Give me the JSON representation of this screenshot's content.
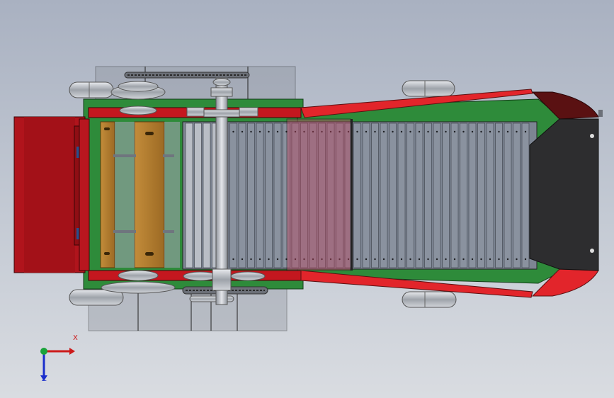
{
  "view": {
    "background_top": "#a9b1c1",
    "background_bottom": "#d9dce1"
  },
  "model": {
    "components": [
      "hopper",
      "belt-conveyor",
      "chain-drive",
      "pulleys",
      "wheels",
      "side-guards"
    ],
    "colors": {
      "hopper": "#b0141c",
      "frame": "#2e8b3a",
      "belt": "#7d8593",
      "guard": "#e2252b",
      "guard_dark": "#5a1112",
      "end_plate": "#2d2d2f",
      "wood": "#b07a2c"
    }
  },
  "triad": {
    "x_label": "X",
    "z_label": "Z",
    "x_color": "#cc1a1a",
    "y_color": "#1aa33a",
    "z_color": "#1a2ecc"
  }
}
